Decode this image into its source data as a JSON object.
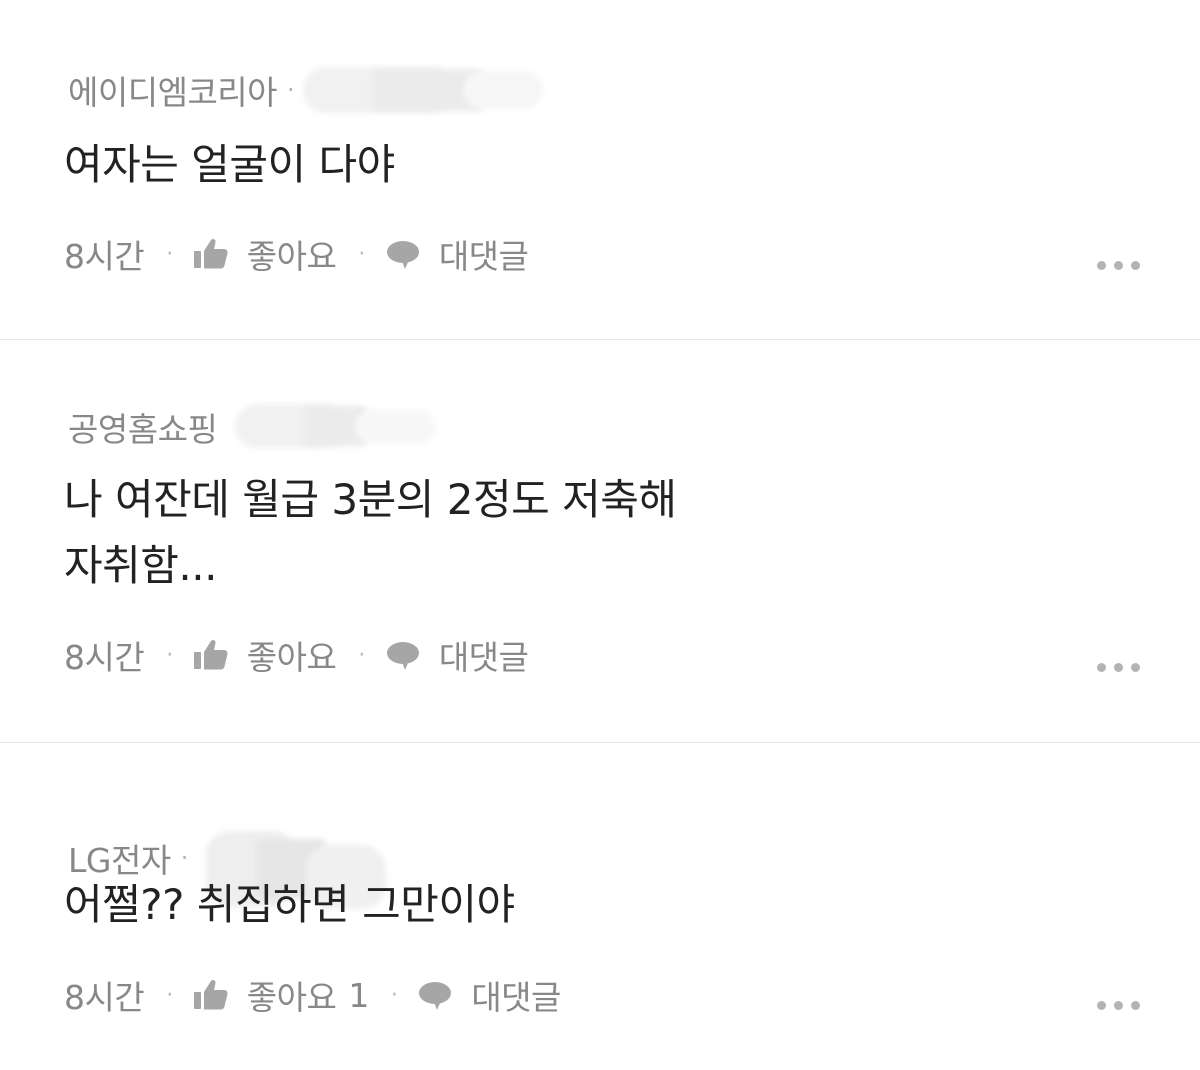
{
  "comments": [
    {
      "author": "에이디엠코리아",
      "separator": "·",
      "body_lines": [
        "여자는 얼굴이 다야"
      ],
      "time": "8시간",
      "like_label": "좋아요",
      "like_count": "",
      "reply_label": "대댓글"
    },
    {
      "author": "공영홈쇼핑",
      "separator": "",
      "body_lines": [
        "나 여잔데 월급 3분의 2정도 저축해",
        "자취함..."
      ],
      "time": "8시간",
      "like_label": "좋아요",
      "like_count": "",
      "reply_label": "대댓글"
    },
    {
      "author": "LG전자",
      "separator": "·",
      "body_lines": [
        "어쩔?? 취집하면 그만이야"
      ],
      "time": "8시간",
      "like_label": "좋아요",
      "like_count": "1",
      "reply_label": "대댓글"
    }
  ],
  "meta_separator": "·",
  "icons": {
    "like": "thumbs-up-icon",
    "reply": "speech-bubble-icon",
    "more": "more-dots-icon"
  },
  "colors": {
    "text_primary": "#222222",
    "text_secondary": "#888888",
    "icon": "#a6a6a6",
    "divider": "#e8e8e8"
  }
}
